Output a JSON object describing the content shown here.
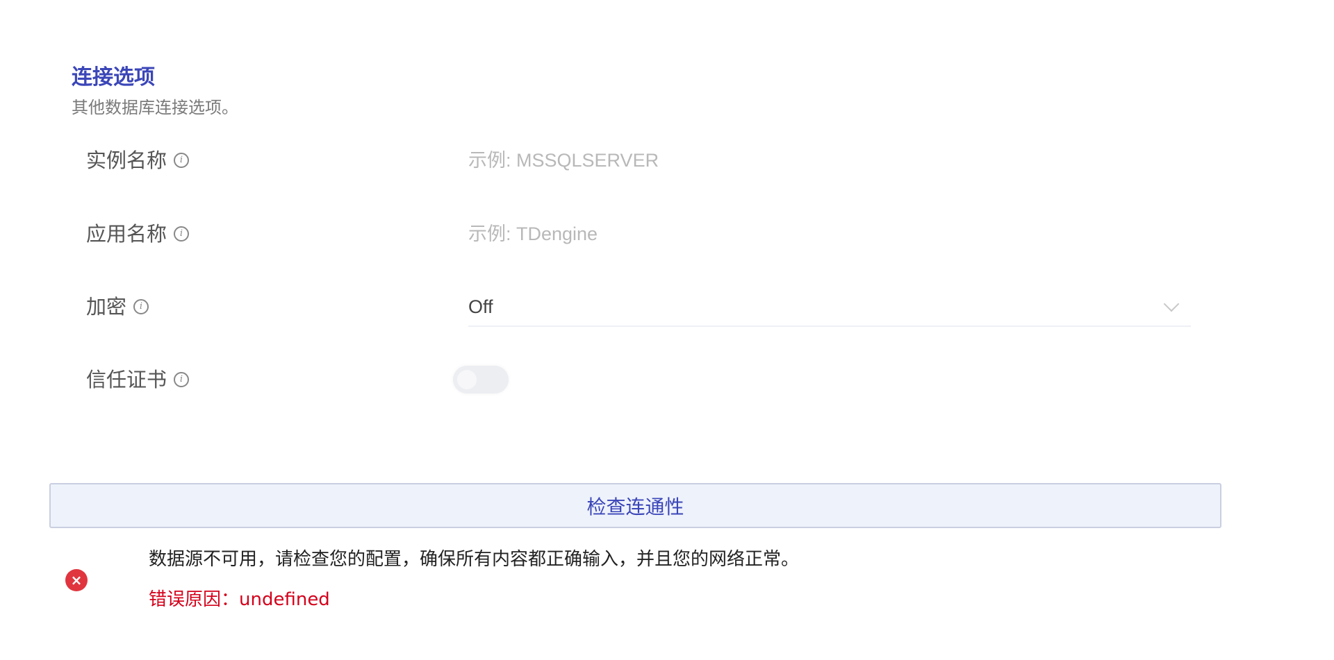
{
  "section": {
    "title": "连接选项",
    "description": "其他数据库连接选项。"
  },
  "fields": {
    "instance_name": {
      "label": "实例名称",
      "placeholder": "示例: MSSQLSERVER",
      "value": ""
    },
    "app_name": {
      "label": "应用名称",
      "placeholder": "示例: TDengine",
      "value": ""
    },
    "encryption": {
      "label": "加密",
      "value": "Off"
    },
    "trust_certificate": {
      "label": "信任证书",
      "enabled": false
    }
  },
  "check_button": {
    "label": "检查连通性"
  },
  "error": {
    "message": "数据源不可用，请检查您的配置，确保所有内容都正确输入，并且您的网络正常。",
    "reason": "错误原因：undefined",
    "icon": "close-icon",
    "color": "#d4001a"
  },
  "colors": {
    "accent": "#3b46b8",
    "error_icon": "#e0353f"
  }
}
